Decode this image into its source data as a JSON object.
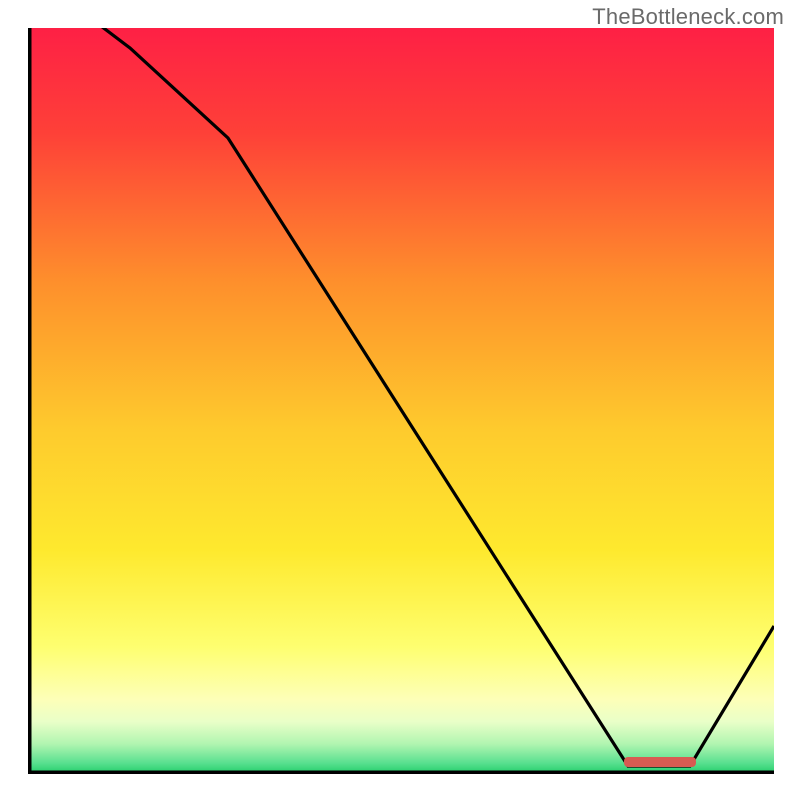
{
  "watermark": "TheBottleneck.com",
  "chart_data": {
    "type": "line",
    "title": "",
    "xlabel": "",
    "ylabel": "",
    "xlim": [
      0,
      100
    ],
    "ylim": [
      0,
      100
    ],
    "x": [
      0,
      10,
      25,
      80,
      88,
      100
    ],
    "values": [
      110,
      103,
      88,
      0,
      0,
      20
    ],
    "annotations": [],
    "background": "heatmap-red-yellow-green",
    "marker": {
      "x": 84,
      "y": 0,
      "label": ""
    }
  },
  "colors": {
    "gradient_top": "#fe2045",
    "gradient_mid_upper": "#fe8f2c",
    "gradient_mid": "#fee92e",
    "gradient_lower": "#feff8f",
    "gradient_green": "#2cd46f",
    "curve": "#000000",
    "axis": "#000000",
    "marker": "#d85b52"
  }
}
